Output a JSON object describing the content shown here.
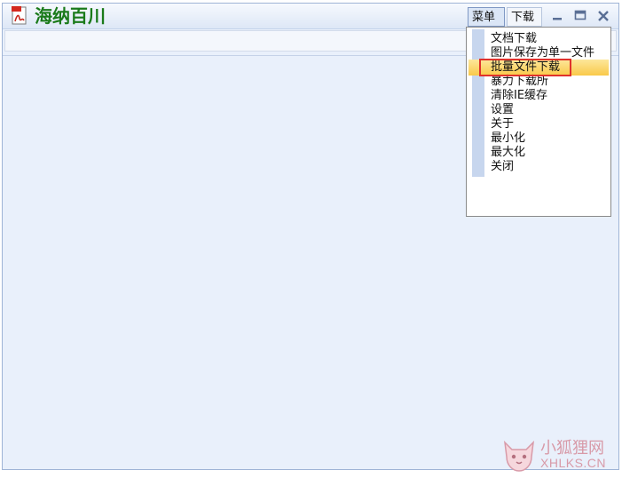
{
  "app": {
    "title": "海纳百川",
    "icon": "pdf-file-icon"
  },
  "titlebar": {
    "menu_label": "菜单",
    "download_label": "下载",
    "controls": [
      "minimize-icon",
      "maximize-icon",
      "close-icon"
    ]
  },
  "dropdown": {
    "items": [
      "文档下载",
      "图片保存为单一文件",
      "批量文件下载",
      "暴力下载所",
      "清除IE缓存",
      "设置",
      "关于",
      "最小化",
      "最大化",
      "关闭"
    ],
    "highlighted": "批量文件下载"
  },
  "watermark": {
    "line1": "小狐狸网",
    "line2": "XHLKS.CN"
  },
  "colors": {
    "title_green": "#1a7a1a",
    "content_bg": "#e9f0fb",
    "highlight": "#f9c94a",
    "highlight_border": "#e0322b",
    "watermark": "#d89aa8"
  }
}
